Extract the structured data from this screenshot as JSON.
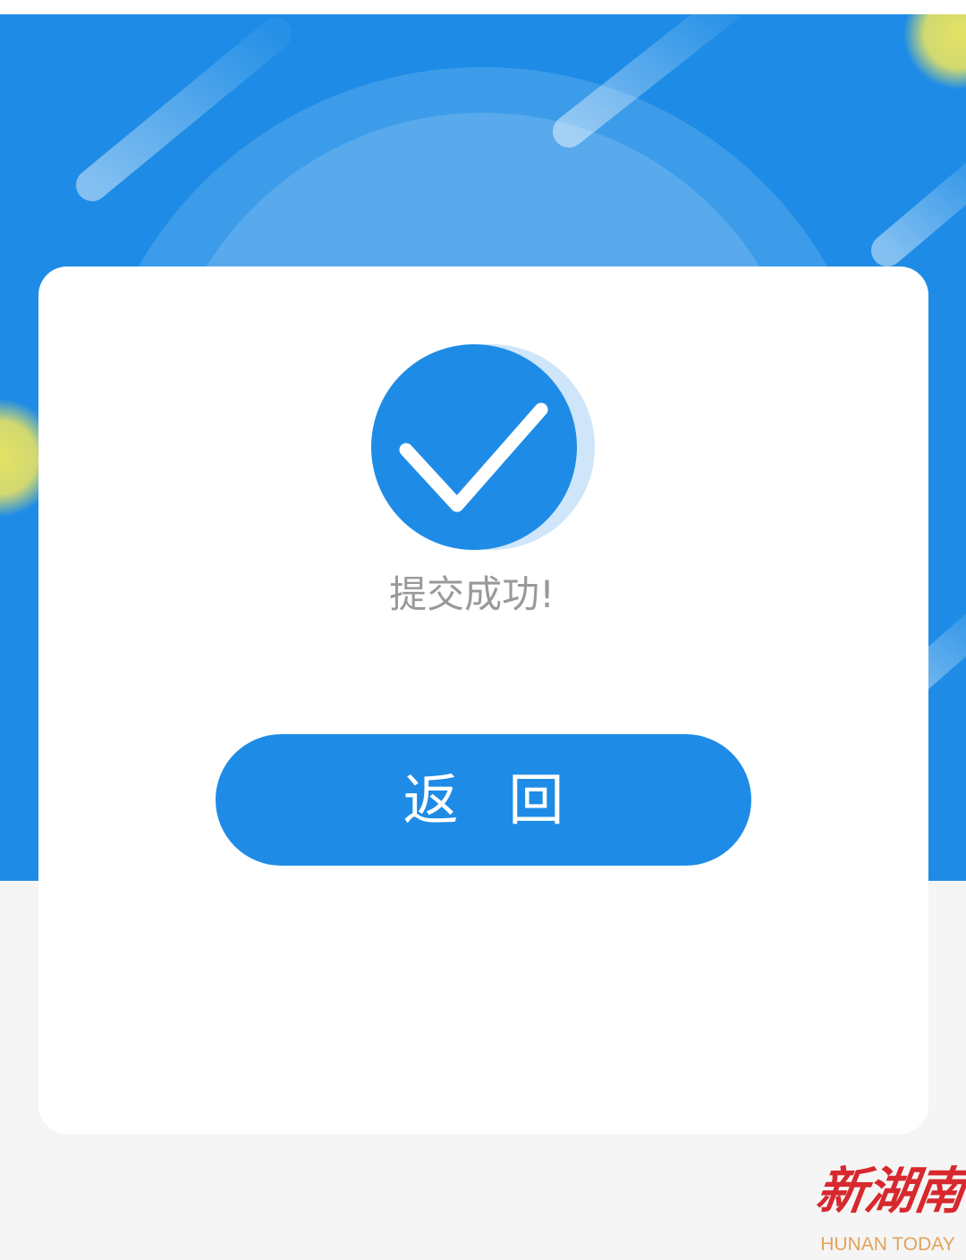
{
  "result": {
    "icon": "check-circle-icon",
    "message": "提交成功!"
  },
  "actions": {
    "back_label": "返 回"
  },
  "branding": {
    "logo_text": "新湖南",
    "logo_subtitle": "HUNAN TODAY"
  },
  "colors": {
    "primary": "#1e8ce6",
    "page_bg": "#f5f5f5",
    "card_bg": "#ffffff",
    "message_text": "#999999",
    "button_text": "#ffffff",
    "logo_red": "#d7282e",
    "logo_orange": "#e2a35b",
    "accent_yellow": "#f0e65c",
    "icon_shadow": "#cfe5f9",
    "status_bar_bg": "#ffffff"
  }
}
